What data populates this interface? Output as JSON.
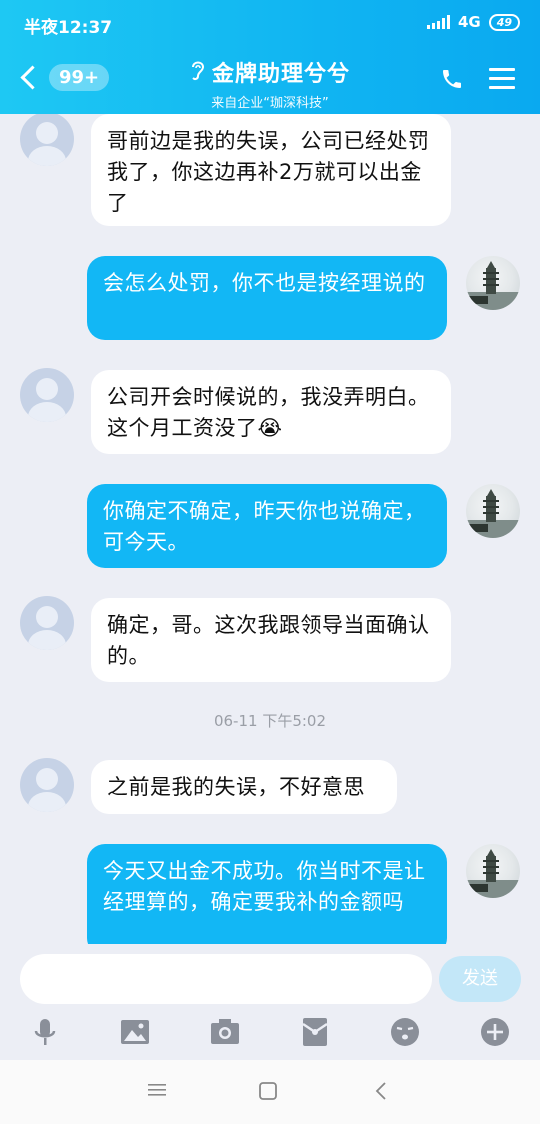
{
  "status": {
    "time": "半夜12:37",
    "network": "4G",
    "battery": "49"
  },
  "header": {
    "back_badge": "99+",
    "title": "金牌助理兮兮",
    "subtitle": "来自企业“珈深科技”"
  },
  "messages": [
    {
      "side": "in",
      "text": "哥前边是我的失误，公司已经处罚我了，你这边再补2万就可以出金了"
    },
    {
      "side": "out",
      "text": "会怎么处罚，你不也是按经理说的"
    },
    {
      "side": "in",
      "text": "公司开会时候说的，我没弄明白。这个月工资没了😭"
    },
    {
      "side": "out",
      "text": "你确定不确定，昨天你也说确定，可今天。"
    },
    {
      "side": "in",
      "text": "确定，哥。这次我跟领导当面确认的。"
    },
    {
      "side": "in",
      "text": "之前是我的失误，不好意思"
    },
    {
      "side": "out",
      "text": "今天又出金不成功。你当时不是让经理算的，确定要我补的金额吗"
    }
  ],
  "timestamp": "06-11 下午5:02",
  "input": {
    "send_label": "发送"
  },
  "toolbar": [
    "mic-icon",
    "image-icon",
    "camera-icon",
    "red-packet-icon",
    "emoji-icon",
    "plus-icon"
  ]
}
